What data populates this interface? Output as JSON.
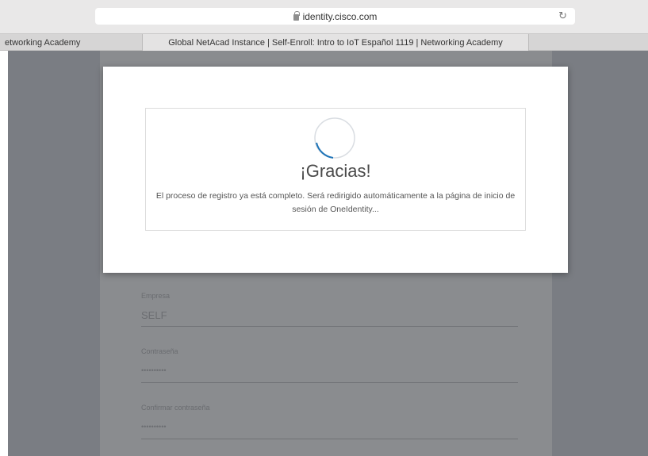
{
  "browser": {
    "url": "identity.cisco.com",
    "tabs": [
      {
        "label": "etworking Academy"
      },
      {
        "label": "Global NetAcad Instance | Self-Enroll: Intro to IoT Español 1119 | Networking Academy"
      }
    ]
  },
  "modal": {
    "title": "¡Gracias!",
    "message": "El proceso de registro ya está completo. Será redirigido automáticamente a la página de inicio de sesión de OneIdentity..."
  },
  "form": {
    "fields": [
      {
        "label": "Empresa",
        "value": "SELF"
      },
      {
        "label": "Contraseña",
        "value": "••••••••••"
      },
      {
        "label": "Confirmar contraseña",
        "value": "••••••••••"
      }
    ]
  },
  "colors": {
    "overlay": "#7a7d83",
    "spinner_arc": "#1e74b8"
  }
}
